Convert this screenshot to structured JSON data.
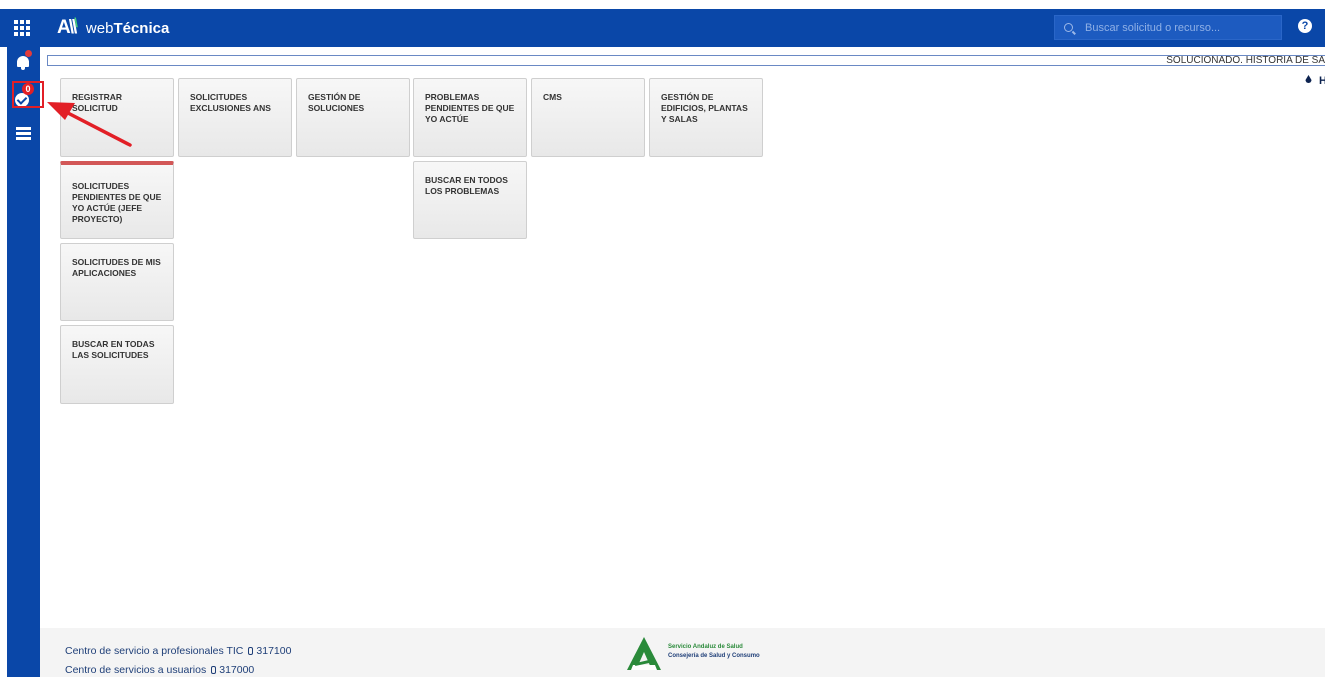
{
  "header": {
    "logo_mark": "A",
    "logo_text_prefix": "web",
    "logo_text_bold": "Técnica",
    "search_placeholder": "Buscar solicitud o recurso...",
    "help_glyph": "?"
  },
  "sidebar": {
    "notification_badge": "0"
  },
  "ticker": {
    "text": "SOLUCIONADO. HISTORIA DE SA"
  },
  "edge_glyph": "H",
  "tiles": [
    "REGISTRAR SOLICITUD",
    "SOLICITUDES EXCLUSIONES ANS",
    "GESTIÓN DE SOLUCIONES",
    "PROBLEMAS PENDIENTES DE QUE YO ACTÚE",
    "CMS",
    "GESTIÓN DE EDIFICIOS, PLANTAS Y SALAS",
    "SOLICITUDES PENDIENTES DE QUE YO ACTÚE (JEFE PROYECTO)",
    "BUSCAR EN TODOS LOS PROBLEMAS",
    "SOLICITUDES DE MIS APLICACIONES",
    "BUSCAR EN TODAS LAS SOLICITUDES"
  ],
  "footer": {
    "line1_label": "Centro de servicio a profesionales TIC",
    "line1_phone": "317100",
    "line2_label": "Centro de servicios a usuarios",
    "line2_phone": "317000",
    "org_name": "Servicio Andaluz de Salud",
    "org_sub": "Consejería de Salud y Consumo"
  },
  "colors": {
    "brand_blue": "#0a47a8",
    "annotation_red": "#e21f26",
    "tile_active_bar": "#d25757",
    "sas_green": "#2a8a3a"
  },
  "icons": [
    "apps-grid-icon",
    "search-icon",
    "help-icon",
    "bell-icon",
    "check-circle-icon",
    "list-icon",
    "drop-icon",
    "phone-icon"
  ]
}
